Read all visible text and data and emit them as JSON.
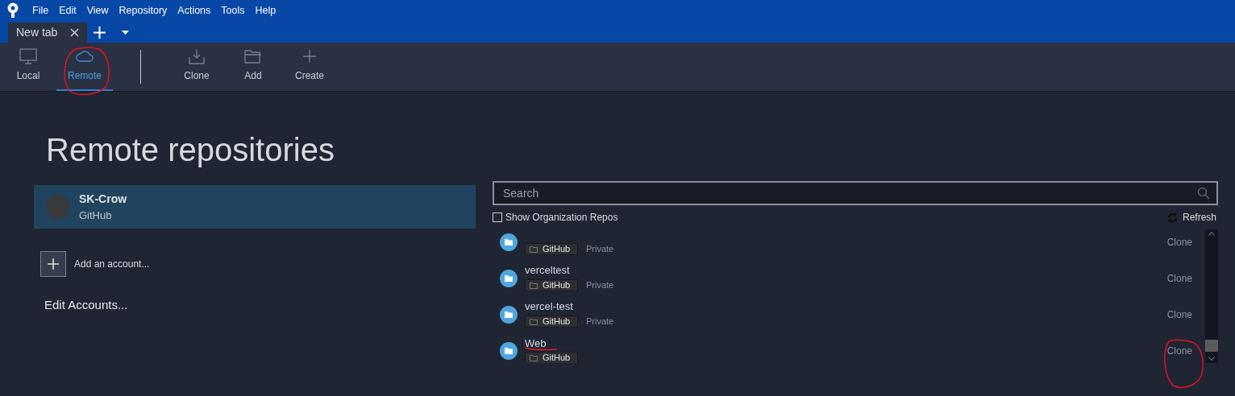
{
  "menu": [
    "File",
    "Edit",
    "View",
    "Repository",
    "Actions",
    "Tools",
    "Help"
  ],
  "tabs": [
    {
      "label": "New tab",
      "selected": true
    }
  ],
  "toolbar": [
    {
      "kind": "local",
      "label": "Local",
      "selected": false
    },
    {
      "kind": "remote",
      "label": "Remote",
      "selected": true
    },
    {
      "kind": "clone",
      "label": "Clone",
      "selected": false
    },
    {
      "kind": "add",
      "label": "Add",
      "selected": false
    },
    {
      "kind": "create",
      "label": "Create",
      "selected": false
    }
  ],
  "heading": "Remote repositories",
  "accounts": [
    {
      "name": "SK-Crow",
      "host": "GitHub",
      "selected": true
    }
  ],
  "add_account": "Add an account...",
  "edit_accounts": "Edit Accounts...",
  "search": {
    "placeholder": "Search"
  },
  "show_org_repos": {
    "label": "Show Organization Repos",
    "checked": false
  },
  "refresh": "Refresh",
  "repos": [
    {
      "host": "GitHub",
      "visibility": "Private",
      "action": "Clone"
    },
    {
      "name": "verceltest",
      "host": "GitHub",
      "visibility": "Private",
      "action": "Clone"
    },
    {
      "name": "vercel-test",
      "host": "GitHub",
      "visibility": "Private",
      "action": "Clone"
    },
    {
      "name": "Web",
      "host": "GitHub",
      "action": "Clone"
    }
  ]
}
